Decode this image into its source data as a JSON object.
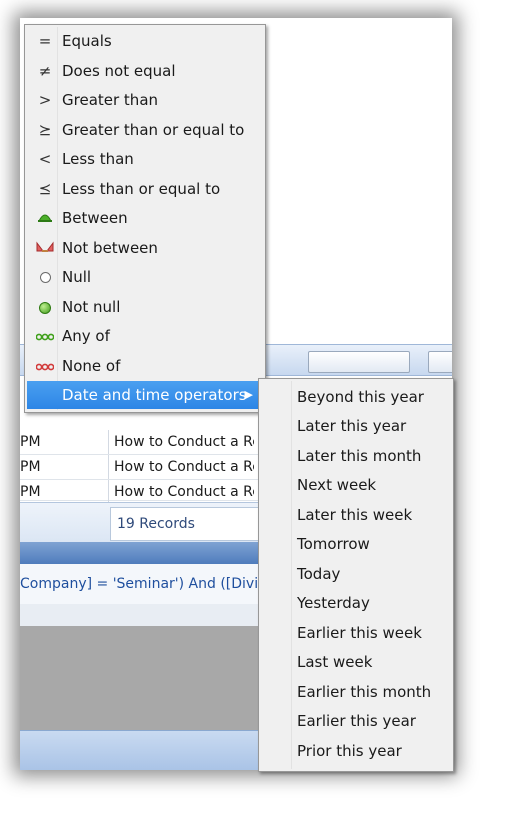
{
  "grid": {
    "rows": [
      {
        "time": "PM",
        "subject": "How to Conduct a Re"
      },
      {
        "time": "PM",
        "subject": "How to Conduct a Re"
      },
      {
        "time": "PM",
        "subject": "How to Conduct a Re"
      }
    ],
    "records_label": "19 Records"
  },
  "filter_bar": {
    "expression": "Company] = 'Seminar') And ([Divisio"
  },
  "operator_menu": {
    "items": [
      {
        "label": "Equals",
        "icon": "equals-icon"
      },
      {
        "label": "Does not equal",
        "icon": "not-equal-icon"
      },
      {
        "label": "Greater than",
        "icon": "greater-than-icon"
      },
      {
        "label": "Greater than or equal to",
        "icon": "greater-or-equal-icon"
      },
      {
        "label": "Less than",
        "icon": "less-than-icon"
      },
      {
        "label": "Less than or equal to",
        "icon": "less-or-equal-icon"
      },
      {
        "label": "Between",
        "icon": "between-icon"
      },
      {
        "label": "Not between",
        "icon": "not-between-icon"
      },
      {
        "label": "Null",
        "icon": "null-icon"
      },
      {
        "label": "Not null",
        "icon": "not-null-icon"
      },
      {
        "label": "Any of",
        "icon": "any-of-icon"
      },
      {
        "label": "None of",
        "icon": "none-of-icon"
      },
      {
        "label": "Date and time operators",
        "icon": "submenu-arrow-icon"
      }
    ],
    "selected": "Date and time operators"
  },
  "date_submenu": {
    "items": [
      "Beyond this year",
      "Later this year",
      "Later this month",
      "Next week",
      "Later this week",
      "Tomorrow",
      "Today",
      "Yesterday",
      "Earlier this week",
      "Last week",
      "Earlier this month",
      "Earlier this year",
      "Prior this year"
    ]
  },
  "colors": {
    "selection": "#3392ea",
    "menu_background": "#f0f0f0",
    "green_icon": "#3f9a1a",
    "red_icon": "#d23a3a"
  }
}
